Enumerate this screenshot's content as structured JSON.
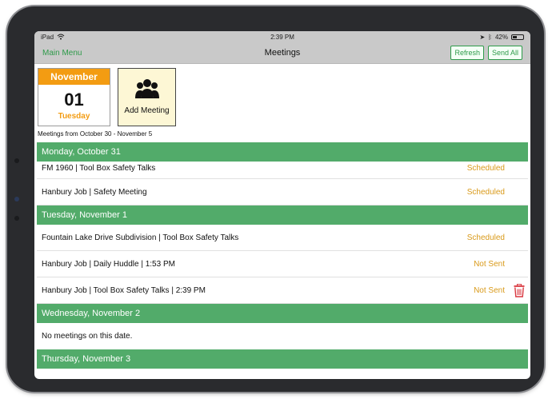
{
  "statusbar": {
    "device": "iPad",
    "time": "2:39 PM",
    "battery": "42%"
  },
  "navbar": {
    "main_menu": "Main Menu",
    "title": "Meetings",
    "refresh": "Refresh",
    "send_all": "Send All"
  },
  "calendar": {
    "month": "November",
    "day": "01",
    "weekday": "Tuesday"
  },
  "add_meeting": {
    "label": "Add Meeting",
    "icon": "group-icon"
  },
  "range_text": "Meetings from October 30 - November 5",
  "days": [
    {
      "date": "Monday, October 31",
      "meetings": [
        {
          "title": "FM 1960 | Tool Box Safety Talks",
          "status": "Scheduled"
        },
        {
          "title": "Hanbury Job | Safety Meeting",
          "status": "Scheduled"
        }
      ]
    },
    {
      "date": "Tuesday, November 1",
      "meetings": [
        {
          "title": "Fountain Lake Drive Subdivision | Tool Box Safety Talks",
          "status": "Scheduled"
        },
        {
          "title": "Hanbury Job | Daily Huddle | 1:53 PM",
          "status": "Not Sent"
        },
        {
          "title": "Hanbury Job | Tool Box Safety Talks | 2:39 PM",
          "status": "Not Sent"
        }
      ]
    },
    {
      "date": "Wednesday, November 2",
      "empty_text": "No meetings on this date."
    },
    {
      "date": "Thursday, November 3"
    }
  ],
  "colors": {
    "accent_green": "#52ab6a",
    "status_orange": "#d99a1a",
    "calendar_orange": "#f39c12",
    "trash_red": "#d9363e"
  }
}
